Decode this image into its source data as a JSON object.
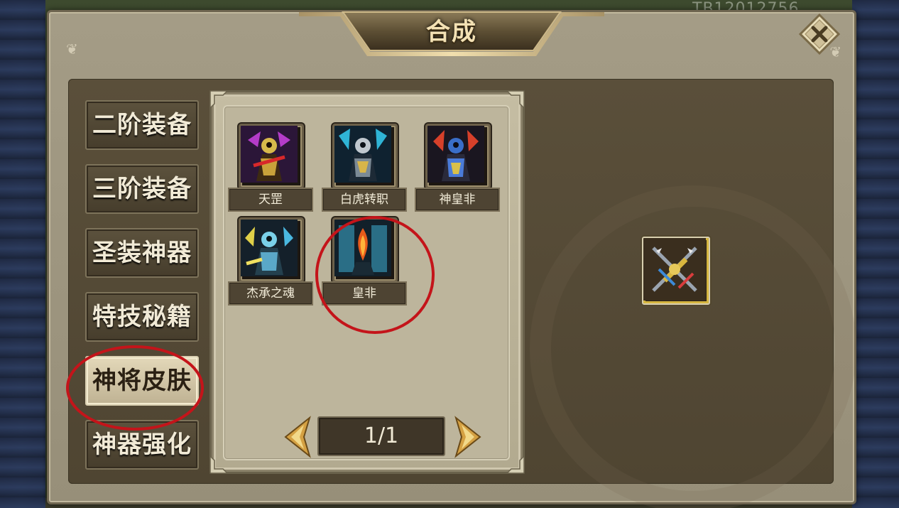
{
  "background": {
    "corner_code": "TB12012756"
  },
  "window": {
    "title": "合成",
    "close_icon": "close-x-icon"
  },
  "tabs": [
    {
      "label": "二阶装备",
      "active": false
    },
    {
      "label": "三阶装备",
      "active": false
    },
    {
      "label": "圣装神器",
      "active": false
    },
    {
      "label": "特技秘籍",
      "active": false
    },
    {
      "label": "神将皮肤",
      "active": true
    },
    {
      "label": "神器强化",
      "active": false
    }
  ],
  "items": [
    {
      "name": "天罡",
      "icon": "armored-general-purple-icon"
    },
    {
      "name": "白虎转职",
      "icon": "white-tiger-general-icon"
    },
    {
      "name": "神皇非",
      "icon": "divine-emperor-general-icon"
    },
    {
      "name": "杰承之魂",
      "icon": "soul-warrior-icon"
    },
    {
      "name": "皇非",
      "icon": "emperor-flame-icon"
    }
  ],
  "pager": {
    "label": "1/1",
    "prev_icon": "arrow-left-icon",
    "next_icon": "arrow-right-icon"
  },
  "result": {
    "icon": "crossed-weapons-icon"
  },
  "colors": {
    "annotation": "#c4141a",
    "accent_gold": "#d6b640"
  }
}
